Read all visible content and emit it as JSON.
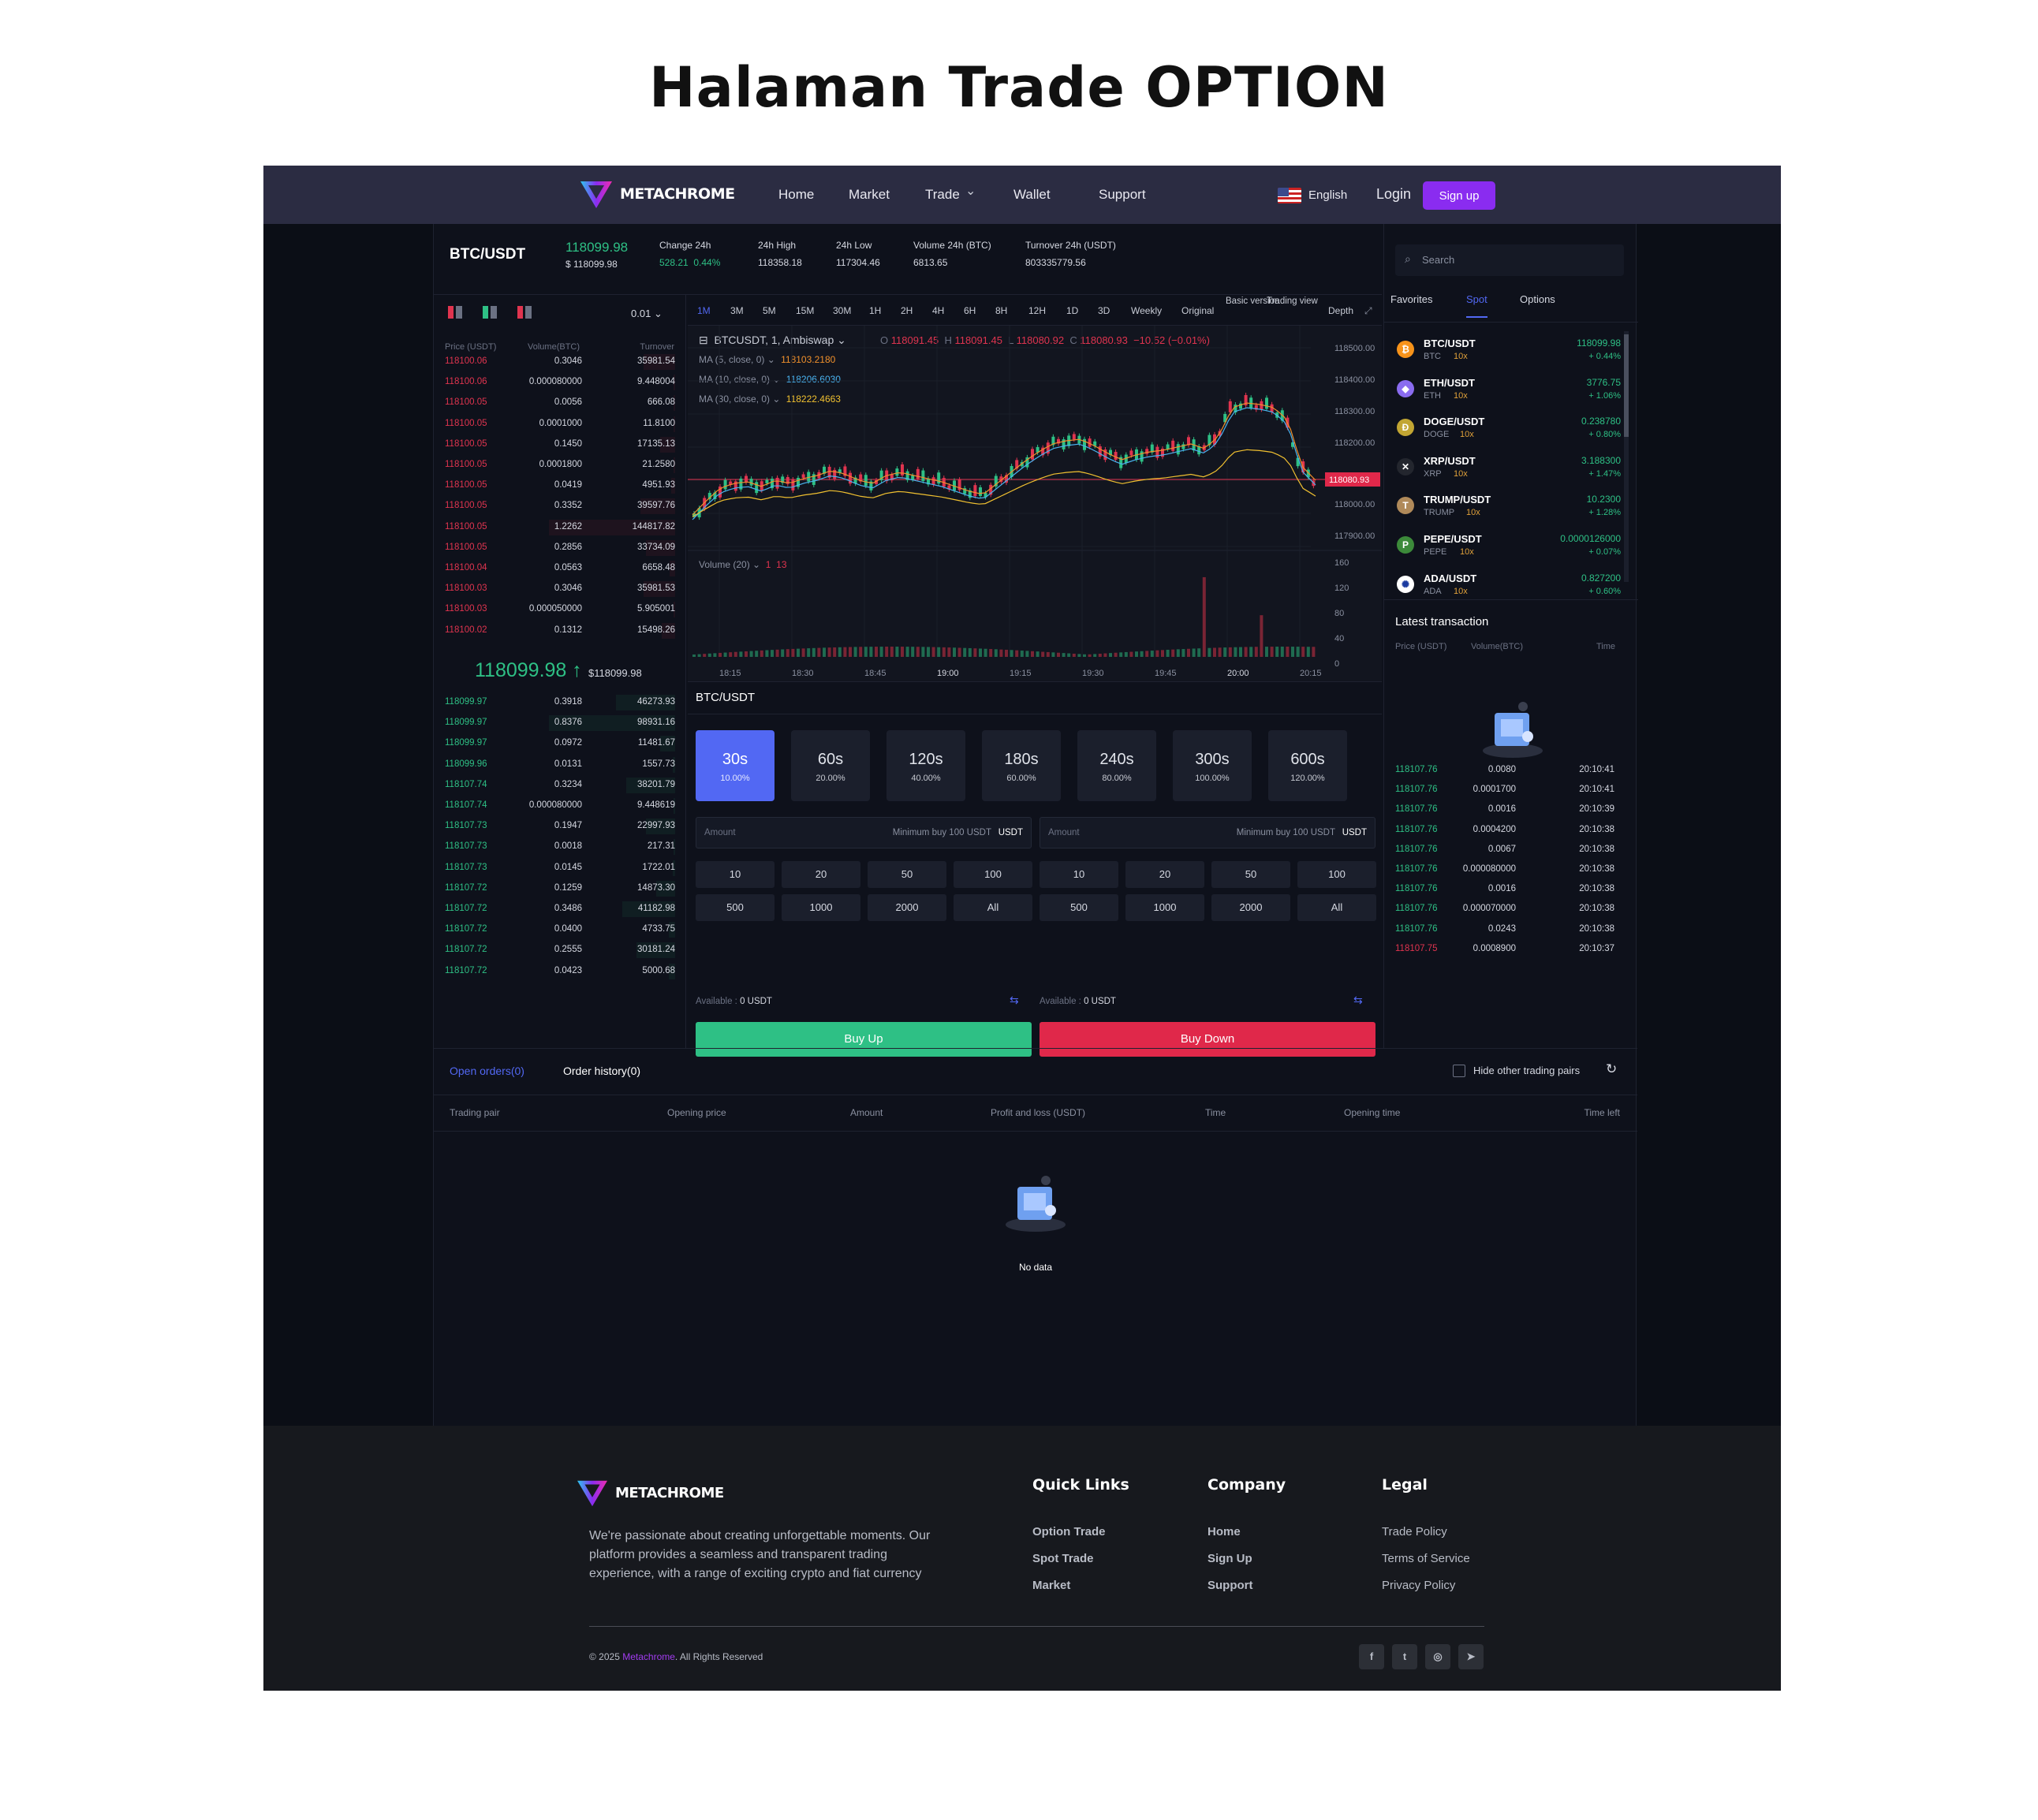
{
  "page_title": "Halaman Trade OPTION",
  "nav": {
    "brand": "METACHROME",
    "links": [
      "Home",
      "Market",
      "Trade",
      "Wallet",
      "Support"
    ],
    "trade_caret": "⌄",
    "language": "English",
    "login": "Login",
    "signup": "Sign up"
  },
  "ticker": {
    "pair": "BTC/USDT",
    "price": "118099.98",
    "price_usd": "$ 118099.98",
    "stats": [
      {
        "label": "Change 24h",
        "value": "528.21",
        "value2": "0.44%"
      },
      {
        "label": "24h High",
        "value": "118358.18"
      },
      {
        "label": "24h Low",
        "value": "117304.46"
      },
      {
        "label": "Volume 24h (BTC)",
        "value": "6813.65"
      },
      {
        "label": "Turnover 24h (USDT)",
        "value": "803335779.56"
      }
    ]
  },
  "orderbook": {
    "precision": "0.01",
    "headers": [
      "Price (USDT)",
      "Volume(BTC)",
      "Turnover"
    ],
    "asks": [
      [
        "118100.06",
        "0.3046",
        "35981.54"
      ],
      [
        "118100.06",
        "0.000080000",
        "9.448004"
      ],
      [
        "118100.05",
        "0.0056",
        "666.08"
      ],
      [
        "118100.05",
        "0.0001000",
        "11.8100"
      ],
      [
        "118100.05",
        "0.1450",
        "17135.13"
      ],
      [
        "118100.05",
        "0.0001800",
        "21.2580"
      ],
      [
        "118100.05",
        "0.0419",
        "4951.93"
      ],
      [
        "118100.05",
        "0.3352",
        "39597.76"
      ],
      [
        "118100.05",
        "1.2262",
        "144817.82"
      ],
      [
        "118100.05",
        "0.2856",
        "33734.09"
      ],
      [
        "118100.04",
        "0.0563",
        "6658.48"
      ],
      [
        "118100.03",
        "0.3046",
        "35981.53"
      ],
      [
        "118100.03",
        "0.000050000",
        "5.905001"
      ],
      [
        "118100.02",
        "0.1312",
        "15498.26"
      ]
    ],
    "mid_price": "118099.98",
    "mid_arrow": "↑",
    "mid_usd": "$118099.98",
    "bids": [
      [
        "118099.97",
        "0.3918",
        "46273.93"
      ],
      [
        "118099.97",
        "0.8376",
        "98931.16"
      ],
      [
        "118099.97",
        "0.0972",
        "11481.67"
      ],
      [
        "118099.96",
        "0.0131",
        "1557.73"
      ],
      [
        "118107.74",
        "0.3234",
        "38201.79"
      ],
      [
        "118107.74",
        "0.000080000",
        "9.448619"
      ],
      [
        "118107.73",
        "0.1947",
        "22997.93"
      ],
      [
        "118107.73",
        "0.0018",
        "217.31"
      ],
      [
        "118107.73",
        "0.0145",
        "1722.01"
      ],
      [
        "118107.72",
        "0.1259",
        "14873.30"
      ],
      [
        "118107.72",
        "0.3486",
        "41182.98"
      ],
      [
        "118107.72",
        "0.0400",
        "4733.75"
      ],
      [
        "118107.72",
        "0.2555",
        "30181.24"
      ],
      [
        "118107.72",
        "0.0423",
        "5000.68"
      ]
    ]
  },
  "chart": {
    "timeframes": [
      "1M",
      "3M",
      "5M",
      "15M",
      "30M",
      "1H",
      "2H",
      "4H",
      "6H",
      "8H",
      "12H",
      "1D",
      "3D",
      "Weekly",
      "Original",
      "Basic version",
      "Trading view",
      "Depth"
    ],
    "symbol_line": "BTCUSDT, 1, Ambiswap",
    "ohlc": {
      "o_label": "O",
      "o": "118091.45",
      "h_label": "H",
      "h": "118091.45",
      "l_label": "L",
      "l": "118080.92",
      "c_label": "C",
      "c": "118080.93",
      "chg": "−10.52 (−0.01%)"
    },
    "ma": [
      {
        "label": "MA (5, close, 0)",
        "value": "118103.2180",
        "color": "#f0902c"
      },
      {
        "label": "MA (10, close, 0)",
        "value": "118206.6030",
        "color": "#4ab3f0"
      },
      {
        "label": "MA (30, close, 0)",
        "value": "118222.4663",
        "color": "#f0c030"
      }
    ],
    "price_axis": [
      "118500.00",
      "118400.00",
      "118300.00",
      "118200.00",
      "118000.00",
      "117900.00"
    ],
    "last_price": "118080.93",
    "volume_label": "Volume (20)",
    "volume_vals": [
      "1",
      "13"
    ],
    "vol_axis": [
      "160",
      "120",
      "80",
      "40",
      "0"
    ],
    "time_axis": [
      "18:15",
      "18:30",
      "18:45",
      "19:00",
      "19:15",
      "19:30",
      "19:45",
      "20:00",
      "20:15"
    ]
  },
  "trade": {
    "pair": "BTC/USDT",
    "durations": [
      {
        "t": "30s",
        "p": "10.00%"
      },
      {
        "t": "60s",
        "p": "20.00%"
      },
      {
        "t": "120s",
        "p": "40.00%"
      },
      {
        "t": "180s",
        "p": "60.00%"
      },
      {
        "t": "240s",
        "p": "80.00%"
      },
      {
        "t": "300s",
        "p": "100.00%"
      },
      {
        "t": "600s",
        "p": "120.00%"
      }
    ],
    "amount_label": "Amount",
    "min_buy": "Minimum buy 100 USDT",
    "currency": "USDT",
    "quick": [
      "10",
      "20",
      "50",
      "100",
      "500",
      "1000",
      "2000",
      "All"
    ],
    "available_label": "Available :",
    "available": "0 USDT",
    "buy_up": "Buy Up",
    "buy_down": "Buy Down"
  },
  "market": {
    "search_placeholder": "Search",
    "tabs": [
      "Favorites",
      "Spot",
      "Options"
    ],
    "items": [
      {
        "pair": "BTC/USDT",
        "sym": "BTC",
        "lev": "10x",
        "price": "118099.98",
        "chg": "+ 0.44%",
        "color": "#f7931a",
        "glyph": "₿"
      },
      {
        "pair": "ETH/USDT",
        "sym": "ETH",
        "lev": "10x",
        "price": "3776.75",
        "chg": "+ 1.06%",
        "color": "#8a6cf0",
        "glyph": "◆"
      },
      {
        "pair": "DOGE/USDT",
        "sym": "DOGE",
        "lev": "10x",
        "price": "0.238780",
        "chg": "+ 0.80%",
        "color": "#c2a633",
        "glyph": "Ð"
      },
      {
        "pair": "XRP/USDT",
        "sym": "XRP",
        "lev": "10x",
        "price": "3.188300",
        "chg": "+ 1.47%",
        "color": "#23262e",
        "glyph": "✕"
      },
      {
        "pair": "TRUMP/USDT",
        "sym": "TRUMP",
        "lev": "10x",
        "price": "10.2300",
        "chg": "+ 1.28%",
        "color": "#b08a5a",
        "glyph": "T"
      },
      {
        "pair": "PEPE/USDT",
        "sym": "PEPE",
        "lev": "10x",
        "price": "0.0000126000",
        "chg": "+ 0.07%",
        "color": "#3c8a3a",
        "glyph": "P"
      },
      {
        "pair": "ADA/USDT",
        "sym": "ADA",
        "lev": "10x",
        "price": "0.827200",
        "chg": "+ 0.60%",
        "color": "#ffffff",
        "glyph": "✺"
      }
    ],
    "latest_title": "Latest transaction",
    "latest_headers": [
      "Price (USDT)",
      "Volume(BTC)",
      "Time"
    ],
    "latest": [
      [
        "118107.76",
        "0.0080",
        "20:10:41"
      ],
      [
        "118107.76",
        "0.0001700",
        "20:10:41"
      ],
      [
        "118107.76",
        "0.0016",
        "20:10:39"
      ],
      [
        "118107.76",
        "0.0004200",
        "20:10:38"
      ],
      [
        "118107.76",
        "0.0067",
        "20:10:38"
      ],
      [
        "118107.76",
        "0.000080000",
        "20:10:38"
      ],
      [
        "118107.76",
        "0.0016",
        "20:10:38"
      ],
      [
        "118107.76",
        "0.000070000",
        "20:10:38"
      ],
      [
        "118107.76",
        "0.0243",
        "20:10:38"
      ],
      [
        "118107.75",
        "0.0008900",
        "20:10:37"
      ]
    ]
  },
  "orders": {
    "tab_open": "Open orders(0)",
    "tab_history": "Order history(0)",
    "hide_label": "Hide other trading pairs",
    "headers": [
      "Trading pair",
      "Opening price",
      "Amount",
      "Profit and loss (USDT)",
      "Time",
      "Opening time",
      "Time left"
    ],
    "empty": "No data"
  },
  "footer": {
    "brand": "METACHROME",
    "about": [
      "We're passionate about creating unforgettable moments. Our",
      "platform provides a seamless and transparent trading",
      "experience, with a range of exciting crypto and fiat currency"
    ],
    "cols": [
      {
        "title": "Quick Links",
        "links": [
          "Option Trade",
          "Spot Trade",
          "Market"
        ]
      },
      {
        "title": "Company",
        "links": [
          "Home",
          "Sign Up",
          "Support"
        ]
      },
      {
        "title": "Legal",
        "links": [
          "Trade Policy",
          "Terms of Service",
          "Privacy Policy"
        ]
      }
    ],
    "copy_pre": "© 2025 ",
    "copy_brand": "Metachrome",
    "copy_post": ". All Rights Reserved",
    "social": [
      "f",
      "t",
      "◎",
      "➤"
    ]
  },
  "colors": {
    "accent": "#8a2cf0",
    "up": "#2ec085",
    "down": "#e0344f",
    "selected": "#5268f3"
  }
}
